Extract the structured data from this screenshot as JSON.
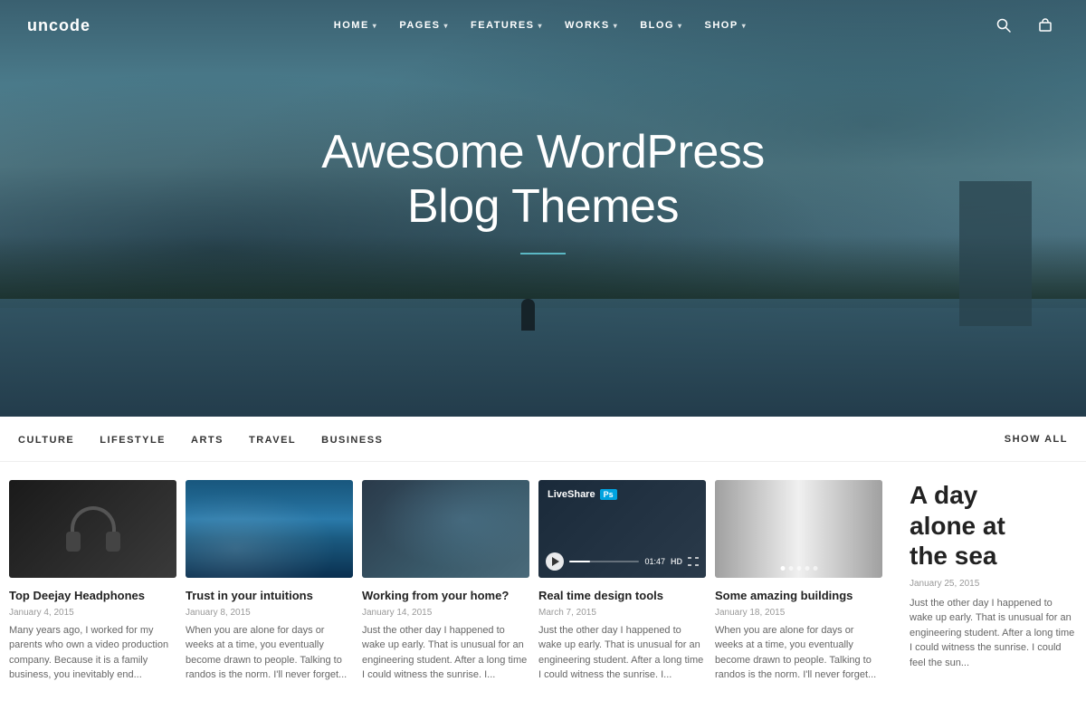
{
  "site": {
    "logo": "uncode"
  },
  "navbar": {
    "links": [
      {
        "id": "home",
        "label": "HOME",
        "has_dropdown": true
      },
      {
        "id": "pages",
        "label": "PAGES",
        "has_dropdown": true
      },
      {
        "id": "features",
        "label": "FEATURES",
        "has_dropdown": true
      },
      {
        "id": "works",
        "label": "WORKS",
        "has_dropdown": true
      },
      {
        "id": "blog",
        "label": "BLOG",
        "has_dropdown": true
      },
      {
        "id": "shop",
        "label": "SHOP",
        "has_dropdown": true
      }
    ]
  },
  "hero": {
    "title_line1": "Awesome WordPress",
    "title_line2": "Blog Themes"
  },
  "filter": {
    "categories": [
      {
        "id": "culture",
        "label": "CULTURE"
      },
      {
        "id": "lifestyle",
        "label": "LIFESTYLE"
      },
      {
        "id": "arts",
        "label": "ARTS"
      },
      {
        "id": "travel",
        "label": "TRAVEL"
      },
      {
        "id": "business",
        "label": "BUSINESS"
      }
    ],
    "show_all": "SHOW ALL"
  },
  "posts": [
    {
      "id": "post-1",
      "title": "Top Deejay Headphones",
      "date": "January 4, 2015",
      "excerpt": "Many years ago, I worked for my parents who own a video production company. Because it is a family business, you inevitably end...",
      "image_type": "headphones",
      "has_image": true
    },
    {
      "id": "post-2",
      "title": "Trust in your intuitions",
      "date": "January 8, 2015",
      "excerpt": "When you are alone for days or weeks at a time, you eventually become drawn to people. Talking to randos is the norm. I'll never forget...",
      "image_type": "waves",
      "has_image": true
    },
    {
      "id": "post-3",
      "title": "Working from your home?",
      "date": "January 14, 2015",
      "excerpt": "Just the other day I happened to wake up early. That is unusual for an engineering student. After a long time I could witness the sunrise. I...",
      "image_type": "laptop",
      "has_image": true
    },
    {
      "id": "post-4",
      "title": "Real time design tools",
      "date": "March 7, 2015",
      "excerpt": "Just the other day I happened to wake up early. That is unusual for an engineering student. After a long time I could witness the sunrise. I...",
      "image_type": "video",
      "has_image": true,
      "video_label": "LiveShare",
      "video_time": "01:47"
    },
    {
      "id": "post-5",
      "title": "Some amazing buildings",
      "date": "January 18, 2015",
      "excerpt": "When you are alone for days or weeks at a time, you eventually become drawn to people. Talking to randos is the norm. I'll never forget...",
      "image_type": "buildings",
      "has_image": true
    },
    {
      "id": "post-6",
      "title": "A day alone at the sea",
      "date": "January 25, 2015",
      "excerpt": "Just the other day I happened to wake up early. That is unusual for an engineering student. After a long time I could witness the sunrise. I could feel the sun...",
      "image_type": "text",
      "has_image": false
    }
  ]
}
